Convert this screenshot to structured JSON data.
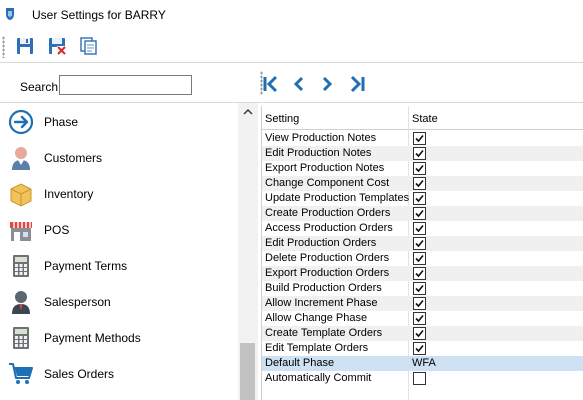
{
  "window": {
    "title": "User Settings for BARRY"
  },
  "toolbar": {
    "save": "save-icon",
    "delete": "delete-save-icon",
    "copy": "copy-icon"
  },
  "search": {
    "label": "Search",
    "value": "",
    "placeholder": ""
  },
  "sidebar": {
    "items": [
      {
        "label": "Phase",
        "icon": "arrow-circle-icon"
      },
      {
        "label": "Customers",
        "icon": "customer-icon"
      },
      {
        "label": "Inventory",
        "icon": "box-icon"
      },
      {
        "label": "POS",
        "icon": "store-icon"
      },
      {
        "label": "Payment Terms",
        "icon": "calculator-icon"
      },
      {
        "label": "Salesperson",
        "icon": "salesperson-icon"
      },
      {
        "label": "Payment Methods",
        "icon": "calculator-icon"
      },
      {
        "label": "Sales Orders",
        "icon": "cart-icon"
      }
    ]
  },
  "navigation": {
    "first": "first-icon",
    "prev": "prev-icon",
    "next": "next-icon",
    "last": "last-icon"
  },
  "grid": {
    "headers": {
      "setting": "Setting",
      "state": "State"
    },
    "rows": [
      {
        "setting": "View Production Notes",
        "checked": true
      },
      {
        "setting": "Edit Production Notes",
        "checked": true
      },
      {
        "setting": "Export Production Notes",
        "checked": true
      },
      {
        "setting": "Change Component Cost",
        "checked": true
      },
      {
        "setting": "Update Production Templates",
        "checked": true
      },
      {
        "setting": "Create Production Orders",
        "checked": true
      },
      {
        "setting": "Access Production Orders",
        "checked": true
      },
      {
        "setting": "Edit Production Orders",
        "checked": true
      },
      {
        "setting": "Delete Production Orders",
        "checked": true
      },
      {
        "setting": "Export Production Orders",
        "checked": true
      },
      {
        "setting": "Build Production Orders",
        "checked": true
      },
      {
        "setting": "Allow Increment Phase",
        "checked": true
      },
      {
        "setting": "Allow Change Phase",
        "checked": true
      },
      {
        "setting": "Create Template Orders",
        "checked": true
      },
      {
        "setting": "Edit Template Orders",
        "checked": true
      },
      {
        "setting": "Default Phase",
        "value": "WFA",
        "selected": true
      },
      {
        "setting": "Automatically Commit",
        "checked": false
      }
    ]
  },
  "colors": {
    "accent": "#1f6fb5",
    "selected_row": "#cde1f3",
    "alt_row": "#f0f0f0"
  }
}
